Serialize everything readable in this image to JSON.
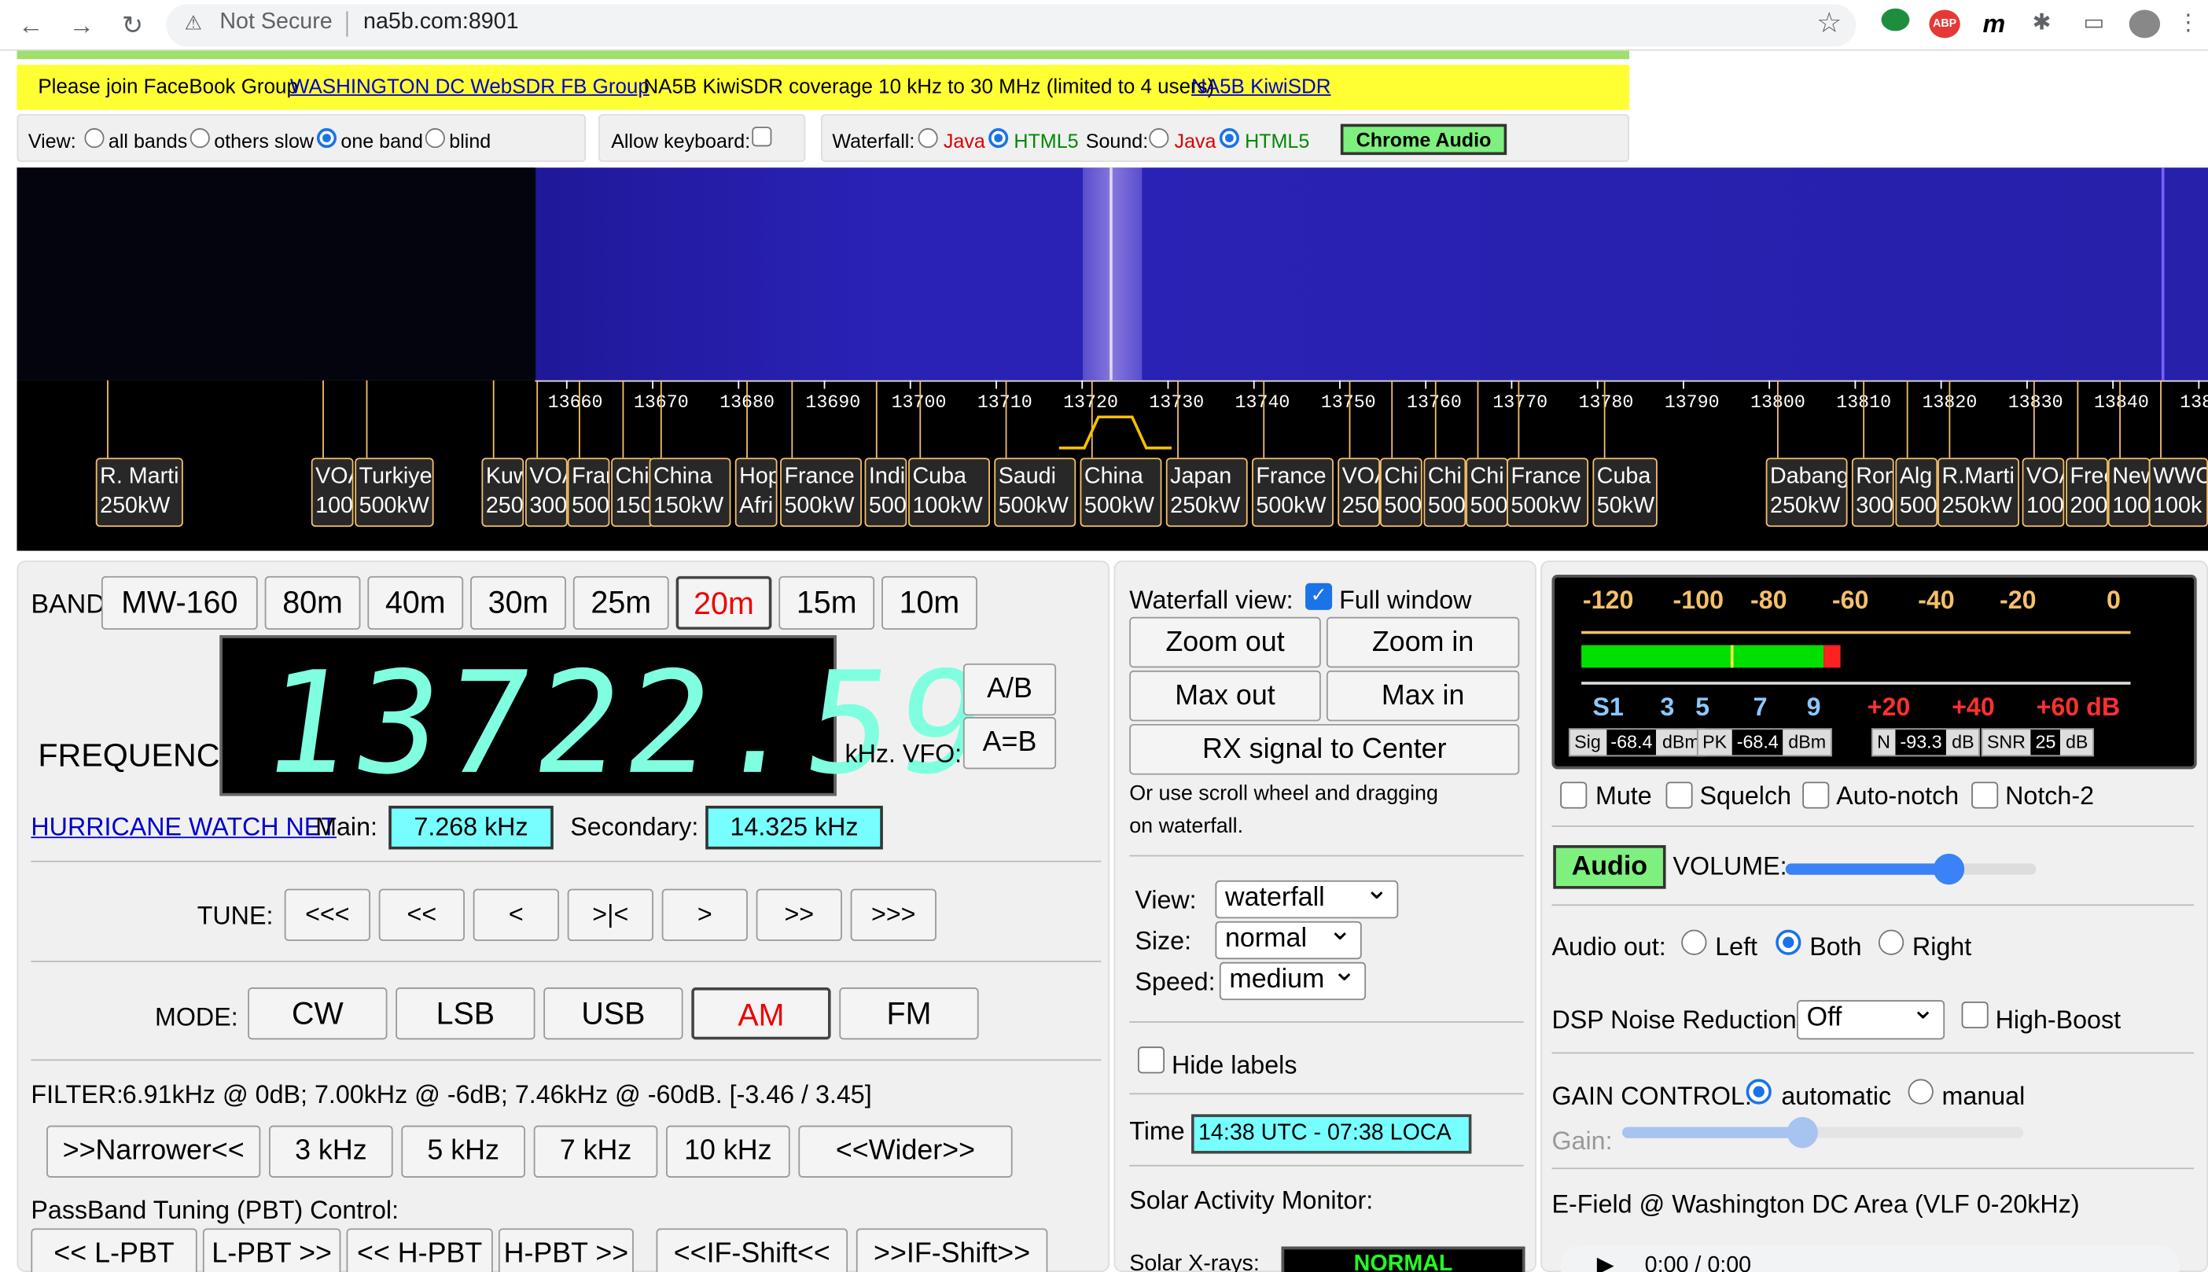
{
  "browser": {
    "security": "Not Secure",
    "url": "na5b.com:8901"
  },
  "banner": {
    "fb_text": "Please join FaceBook Group",
    "fb_link": "WASHINGTON DC WebSDR FB Group",
    "kiwi_text": "NA5B KiwiSDR coverage 10 kHz to 30 MHz (limited to 4 users)",
    "kiwi_link": "NA5B KiwiSDR"
  },
  "view_bar": {
    "view_label": "View:",
    "options": [
      "all bands",
      "others slow",
      "one band",
      "blind"
    ],
    "selected": "one band",
    "keyboard_label": "Allow keyboard:",
    "waterfall_label": "Waterfall:",
    "sound_label": "Sound:",
    "java": "Java",
    "html5": "HTML5",
    "chrome_audio": "Chrome Audio"
  },
  "scale": {
    "ticks": [
      "13660",
      "13670",
      "13680",
      "13690",
      "13700",
      "13710",
      "13720",
      "13730",
      "13740",
      "13750",
      "13760",
      "13770",
      "13780",
      "13790",
      "13800",
      "13810",
      "13820",
      "13830",
      "13840",
      "138"
    ]
  },
  "stations": [
    {
      "name": "R. Marti",
      "power": "250kW"
    },
    {
      "name": "VOA",
      "power": "100"
    },
    {
      "name": "Turkiye",
      "power": "500kW"
    },
    {
      "name": "Kuw",
      "power": "250"
    },
    {
      "name": "VOA",
      "power": "300"
    },
    {
      "name": "Fran",
      "power": "500"
    },
    {
      "name": "Chi",
      "power": "150"
    },
    {
      "name": "China",
      "power": "150kW"
    },
    {
      "name": "Hop",
      "power": "Afri"
    },
    {
      "name": "France",
      "power": "500kW"
    },
    {
      "name": "Indi",
      "power": "500"
    },
    {
      "name": "Cuba",
      "power": "100kW"
    },
    {
      "name": "Saudi",
      "power": "500kW"
    },
    {
      "name": "China",
      "power": "500kW"
    },
    {
      "name": "Japan",
      "power": "250kW"
    },
    {
      "name": "France",
      "power": "500kW"
    },
    {
      "name": "VOA",
      "power": "250"
    },
    {
      "name": "Chi",
      "power": "500"
    },
    {
      "name": "Chi",
      "power": "500"
    },
    {
      "name": "Chi",
      "power": "500"
    },
    {
      "name": "France",
      "power": "500kW"
    },
    {
      "name": "Cuba",
      "power": "50kW"
    },
    {
      "name": "Dabang",
      "power": "250kW"
    },
    {
      "name": "Ron",
      "power": "300"
    },
    {
      "name": "Alg",
      "power": "500"
    },
    {
      "name": "R.Marti",
      "power": "250kW"
    },
    {
      "name": "VOA",
      "power": "100"
    },
    {
      "name": "Free",
      "power": "200"
    },
    {
      "name": "New",
      "power": "100"
    },
    {
      "name": "WWC",
      "power": "100k"
    }
  ],
  "band": {
    "label": "BAND:",
    "buttons": [
      "MW-160",
      "80m",
      "40m",
      "30m",
      "25m",
      "20m",
      "15m",
      "10m"
    ],
    "selected": "20m"
  },
  "frequency": {
    "label": "FREQUENCY:",
    "value": "13722.59",
    "unit": "kHz. VFO:",
    "ab": "A/B",
    "aeqb": "A=B"
  },
  "hwn": {
    "link": "HURRICANE WATCH NET",
    "main_label": "Main:",
    "main_value": "7.268 kHz",
    "secondary_label": "Secondary:",
    "secondary_value": "14.325 kHz"
  },
  "tune": {
    "label": "TUNE:",
    "buttons": [
      "<<<",
      "<<",
      "<",
      ">|<",
      ">",
      ">>",
      ">>>"
    ]
  },
  "mode": {
    "label": "MODE:",
    "buttons": [
      "CW",
      "LSB",
      "USB",
      "AM",
      "FM"
    ],
    "selected": "AM"
  },
  "filter": {
    "label": "FILTER:",
    "text": "6.91kHz @ 0dB; 7.00kHz @ -6dB; 7.46kHz @ -60dB. [-3.46 / 3.45]",
    "buttons": [
      ">>Narrower<<",
      "3 kHz",
      "5 kHz",
      "7 kHz",
      "10 kHz",
      "<<Wider>>"
    ]
  },
  "pbt": {
    "label": "PassBand Tuning (PBT) Control:",
    "buttons": [
      "<< L-PBT",
      "L-PBT >>",
      "<< H-PBT",
      "H-PBT >>",
      "<<IF-Shift<<",
      ">>IF-Shift>>"
    ]
  },
  "waterfall_view": {
    "label": "Waterfall view:",
    "full_window": "Full window",
    "zoom_out": "Zoom out",
    "zoom_in": "Zoom in",
    "max_out": "Max out",
    "max_in": "Max in",
    "rx_center": "RX signal to Center",
    "hint1": "Or use scroll wheel and dragging",
    "hint2": "on waterfall.",
    "view_label": "View:",
    "view_value": "waterfall",
    "size_label": "Size:",
    "size_value": "normal",
    "speed_label": "Speed:",
    "speed_value": "medium",
    "hide_labels": "Hide labels",
    "time_label": "Time",
    "time_value": "14:38 UTC - 07:38 LOCA",
    "solar_label": "Solar Activity Monitor:",
    "solar_xrays": "Solar X-rays:",
    "solar_status": "NORMAL"
  },
  "meter": {
    "scale_top": [
      "-120",
      "-100",
      "-80",
      "-60",
      "-40",
      "-20",
      "0"
    ],
    "scale_bottom": [
      "S1",
      "3",
      "5",
      "7",
      "9",
      "+20",
      "+40",
      "+60 dB"
    ],
    "sig_label": "Sig",
    "sig_value": "-68.4",
    "sig_unit": "dBm",
    "pk_label": "PK",
    "pk_value": "-68.4",
    "pk_unit": "dBm",
    "n_label": "N",
    "n_value": "-93.3",
    "n_unit": "dB",
    "snr_label": "SNR",
    "snr_value": "25",
    "snr_unit": "dB",
    "level_fraction": 0.49
  },
  "audio": {
    "mute": "Mute",
    "squelch": "Squelch",
    "autonotch": "Auto-notch",
    "notch2": "Notch-2",
    "audio_btn": "Audio",
    "volume_label": "VOLUME:",
    "volume_fraction": 0.65,
    "audio_out_label": "Audio out:",
    "left": "Left",
    "both": "Both",
    "right": "Right",
    "dsp_label": "DSP Noise Reduction:",
    "dsp_value": "Off",
    "high_boost": "High-Boost",
    "gain_label": "GAIN CONTROL:",
    "automatic": "automatic",
    "manual": "manual",
    "gain_sub": "Gain:",
    "gain_fraction": 0.45,
    "efield": "E-Field @ Washington DC Area (VLF 0-20kHz)",
    "player_time": "0:00 / 0:00"
  }
}
